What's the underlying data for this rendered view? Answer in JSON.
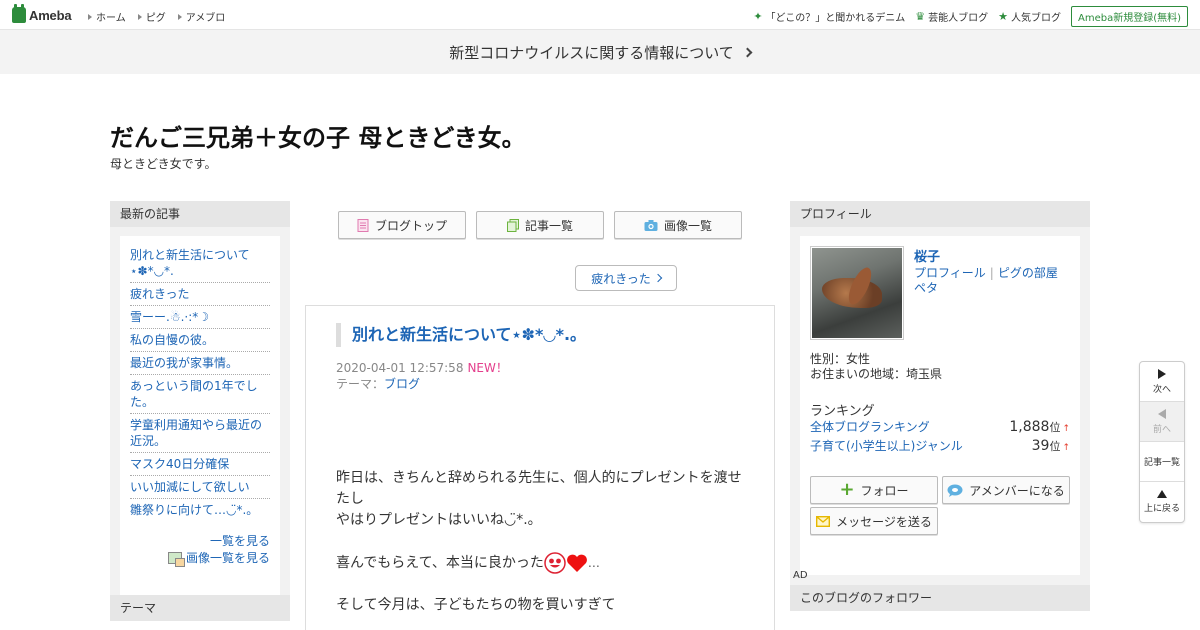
{
  "topbar": {
    "logo_text": "Ameba",
    "nav": [
      "ホーム",
      "ピグ",
      "アメブロ"
    ],
    "right_links": [
      "「どこの？」と聞かれるデニム",
      "芸能人ブログ",
      "人気ブログ"
    ],
    "register_label": "Ameba新規登録(無料)"
  },
  "notice": {
    "text": "新型コロナウイルスに関する情報について"
  },
  "blog": {
    "title": "だんご三兄弟＋女の子 母ときどき女。",
    "description": "母ときどき女です。"
  },
  "left": {
    "recent_heading": "最新の記事",
    "recent_entries": [
      "別れと新生活について⋆✽*◡*.",
      "疲れきった",
      "雪ーー.☃.·:*☽",
      "私の自慢の彼。",
      "最近の我が家事情。",
      "あっという間の1年でした。",
      "学童利用通知やら最近の近況。",
      "マスク40日分確保",
      "いい加減にして欲しい",
      "雛祭りに向けて…◡̈*.。"
    ],
    "see_all_label": "一覧を見る",
    "image_list_label": "画像一覧を見る",
    "theme_heading": "テーマ"
  },
  "center": {
    "nav_buttons": [
      "ブログトップ",
      "記事一覧",
      "画像一覧"
    ],
    "prev_article_label": "疲れきった",
    "article": {
      "title": "別れと新生活について⋆✽*◡*.。",
      "date": "2020-04-01 12:57:58",
      "new_badge": "NEW！",
      "theme_prefix": "テーマ：",
      "theme": "ブログ",
      "paragraphs": [
        "昨日は、きちんと辞められる先生に、個人的にプレゼントを渡せたし",
        "やはりプレゼントはいいね◡̈*.。",
        "喜んでもらえて、本当に良かった",
        "…",
        "そして今月は、子どもたちの物を買いすぎて"
      ]
    }
  },
  "right": {
    "profile_heading": "プロフィール",
    "name": "桜子",
    "links": [
      "プロフィール",
      "ピグの部屋",
      "ペタ"
    ],
    "gender": "性別：女性",
    "area": "お住まいの地域：埼玉県",
    "ranking_heading": "ランキング",
    "rankings": [
      {
        "label": "全体ブログランキング",
        "value": "1,888",
        "unit": "位",
        "arrow": "↑"
      },
      {
        "label": "子育て(小学生以上)ジャンル",
        "value": "39",
        "unit": "位",
        "arrow": "↑"
      }
    ],
    "follow_label": "フォロー",
    "amember_label": "アメンバーになる",
    "message_label": "メッセージを送る",
    "ad_label": "AD",
    "followers_heading": "このブログのフォロワー"
  },
  "sidenav": {
    "next": "次へ",
    "prev": "前へ",
    "list": "記事一覧",
    "top": "上に戻る"
  },
  "colors": {
    "link": "#1d65b5",
    "brand": "#2d8c3c",
    "new": "#e43e8c"
  }
}
